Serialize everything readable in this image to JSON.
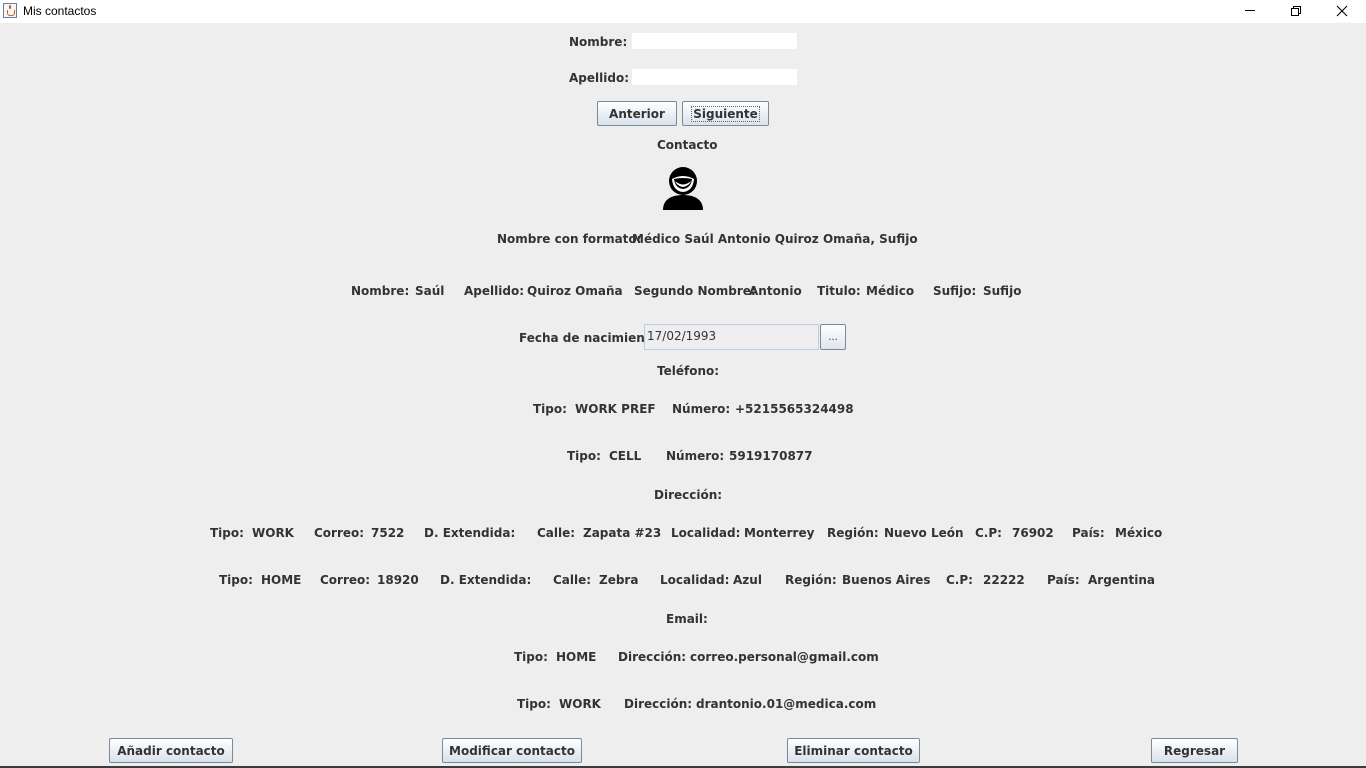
{
  "window": {
    "title": "Mis contactos"
  },
  "search": {
    "nombre_label": "Nombre:",
    "nombre_value": "",
    "apellido_label": "Apellido:",
    "apellido_value": ""
  },
  "nav": {
    "prev_label": "Anterior",
    "next_label": "Siguiente"
  },
  "contact": {
    "header": "Contacto",
    "formatted_label": "Nombre con formato:",
    "formatted_value": "Médico Saúl Antonio Quiroz Omaña, Sufijo",
    "name": {
      "nombre_label": "Nombre:",
      "nombre": "Saúl",
      "apellido_label": "Apellido:",
      "apellido": "Quiroz Omaña",
      "segundo_label": "Segundo Nombre:",
      "segundo": "Antonio",
      "titulo_label": "Titulo:",
      "titulo": "Médico",
      "sufijo_label": "Sufijo:",
      "sufijo": "Sufijo"
    },
    "birth": {
      "label": "Fecha de nacimiento:",
      "value": "17/02/1993",
      "picker_label": "..."
    },
    "phones_header": "Teléfono:",
    "phones": [
      {
        "tipo_label": "Tipo:",
        "tipo": "WORK PREF",
        "numero_label": "Número:",
        "numero": "+5215565324498"
      },
      {
        "tipo_label": "Tipo:",
        "tipo": "CELL",
        "numero_label": "Número:",
        "numero": "5919170877"
      }
    ],
    "address_header": "Dirección:",
    "addresses": [
      {
        "tipo_label": "Tipo:",
        "tipo": "WORK",
        "correo_label": "Correo:",
        "correo": "7522",
        "ext_label": "D. Extendida:",
        "ext": "",
        "calle_label": "Calle:",
        "calle": "Zapata #23",
        "localidad_label": "Localidad:",
        "localidad": "Monterrey",
        "region_label": "Región:",
        "region": "Nuevo León",
        "cp_label": "C.P:",
        "cp": "76902",
        "pais_label": "País:",
        "pais": "México"
      },
      {
        "tipo_label": "Tipo:",
        "tipo": "HOME",
        "correo_label": "Correo:",
        "correo": "18920",
        "ext_label": "D. Extendida:",
        "ext": "",
        "calle_label": "Calle:",
        "calle": "Zebra",
        "localidad_label": "Localidad:",
        "localidad": "Azul",
        "region_label": "Región:",
        "region": "Buenos Aires",
        "cp_label": "C.P:",
        "cp": "22222",
        "pais_label": "País:",
        "pais": "Argentina"
      }
    ],
    "email_header": "Email:",
    "emails": [
      {
        "tipo_label": "Tipo:",
        "tipo": "HOME",
        "dir_label": "Dirección:",
        "dir": "correo.personal@gmail.com"
      },
      {
        "tipo_label": "Tipo:",
        "tipo": "WORK",
        "dir_label": "Dirección:",
        "dir": "drantonio.01@medica.com"
      }
    ]
  },
  "actions": {
    "add": "Añadir contacto",
    "modify": "Modificar contacto",
    "delete": "Eliminar contacto",
    "back": "Regresar"
  },
  "icons": {
    "app": "java-cup-icon",
    "avatar": "person-avatar-icon",
    "minimize": "minimize-icon",
    "maximize": "restore-icon",
    "close": "close-icon"
  }
}
